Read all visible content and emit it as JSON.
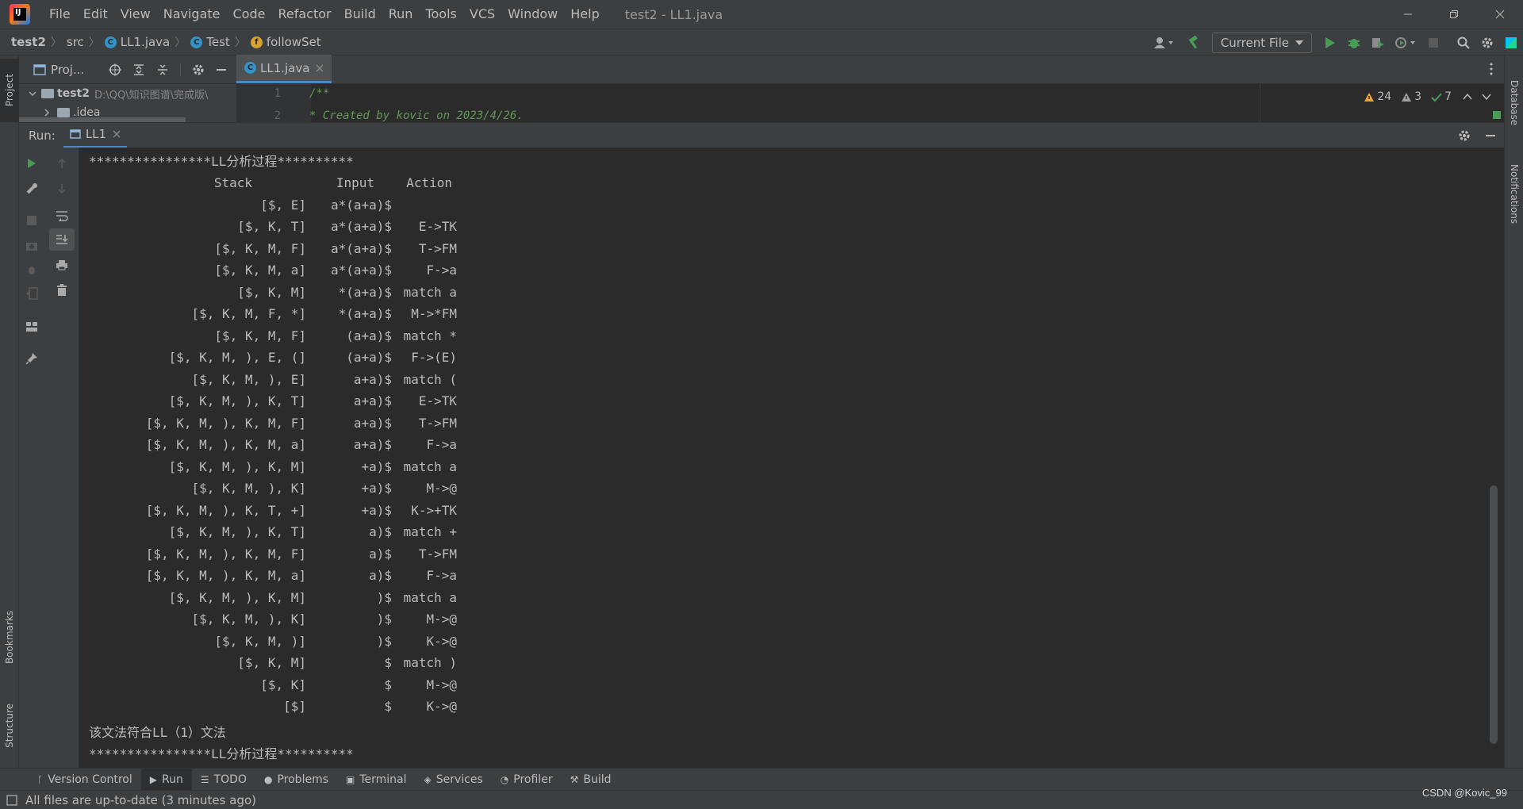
{
  "menubar": {
    "items": [
      "File",
      "Edit",
      "View",
      "Navigate",
      "Code",
      "Refactor",
      "Build",
      "Run",
      "Tools",
      "VCS",
      "Window",
      "Help"
    ],
    "window_title": "test2 - LL1.java"
  },
  "breadcrumbs": {
    "project": "test2",
    "src": "src",
    "file": "LL1.java",
    "class": "Test",
    "method": "followSet"
  },
  "toolbar": {
    "run_config": "Current File"
  },
  "left_strip": {
    "project": "Project",
    "bookmarks": "Bookmarks",
    "structure": "Structure"
  },
  "right_strip": {
    "database": "Database",
    "notifications": "Notifications"
  },
  "project_panel": {
    "title": "Proj...",
    "root_name": "test2",
    "root_path": "D:\\QQ\\知识图谱\\完成版\\",
    "child": ".idea"
  },
  "editor": {
    "tab_label": "LL1.java",
    "lines": [
      {
        "num": "1",
        "text": "/**"
      },
      {
        "num": "2",
        "text": " *  Created by kovic on 2023/4/26."
      }
    ],
    "inspections": {
      "warnings": "24",
      "weak_warnings": "3",
      "typos": "7"
    }
  },
  "run_panel": {
    "label": "Run:",
    "tab": "LL1",
    "console_header": "****************LL分析过程**********",
    "column_headers": {
      "stack": "Stack",
      "input": "Input",
      "action": "Action"
    },
    "rows": [
      {
        "stack": "[$, E]",
        "input": "a*(a+a)$",
        "action": ""
      },
      {
        "stack": "[$, K, T]",
        "input": "a*(a+a)$",
        "action": "E->TK"
      },
      {
        "stack": "[$, K, M, F]",
        "input": "a*(a+a)$",
        "action": "T->FM"
      },
      {
        "stack": "[$, K, M, a]",
        "input": "a*(a+a)$",
        "action": "F->a"
      },
      {
        "stack": "[$, K, M]",
        "input": "*(a+a)$",
        "action": "match a"
      },
      {
        "stack": "[$, K, M, F, *]",
        "input": "*(a+a)$",
        "action": "M->*FM"
      },
      {
        "stack": "[$, K, M, F]",
        "input": "(a+a)$",
        "action": "match *"
      },
      {
        "stack": "[$, K, M, ), E, (]",
        "input": "(a+a)$",
        "action": "F->(E)"
      },
      {
        "stack": "[$, K, M, ), E]",
        "input": "a+a)$",
        "action": "match ("
      },
      {
        "stack": "[$, K, M, ), K, T]",
        "input": "a+a)$",
        "action": "E->TK"
      },
      {
        "stack": "[$, K, M, ), K, M, F]",
        "input": "a+a)$",
        "action": "T->FM"
      },
      {
        "stack": "[$, K, M, ), K, M, a]",
        "input": "a+a)$",
        "action": "F->a"
      },
      {
        "stack": "[$, K, M, ), K, M]",
        "input": "+a)$",
        "action": "match a"
      },
      {
        "stack": "[$, K, M, ), K]",
        "input": "+a)$",
        "action": "M->@"
      },
      {
        "stack": "[$, K, M, ), K, T, +]",
        "input": "+a)$",
        "action": "K->+TK"
      },
      {
        "stack": "[$, K, M, ), K, T]",
        "input": "a)$",
        "action": "match +"
      },
      {
        "stack": "[$, K, M, ), K, M, F]",
        "input": "a)$",
        "action": "T->FM"
      },
      {
        "stack": "[$, K, M, ), K, M, a]",
        "input": "a)$",
        "action": "F->a"
      },
      {
        "stack": "[$, K, M, ), K, M]",
        "input": ")$",
        "action": "match a"
      },
      {
        "stack": "[$, K, M, ), K]",
        "input": ")$",
        "action": "M->@"
      },
      {
        "stack": "[$, K, M, )]",
        "input": ")$",
        "action": "K->@"
      },
      {
        "stack": "[$, K, M]",
        "input": "$",
        "action": "match )"
      },
      {
        "stack": "[$, K]",
        "input": "$",
        "action": "M->@"
      },
      {
        "stack": "[$]",
        "input": "$",
        "action": "K->@"
      }
    ],
    "result": "该文法符合LL（1）文法",
    "console_footer": "****************LL分析过程**********"
  },
  "bottom_tabs": [
    "Version Control",
    "Run",
    "TODO",
    "Problems",
    "Terminal",
    "Services",
    "Profiler",
    "Build"
  ],
  "status": {
    "message": "All files are up-to-date (3 minutes ago)",
    "watermark": "CSDN @Kovic_99"
  },
  "colors": {
    "accent": "#4a88c7",
    "background": "#2b2b2b",
    "panel": "#3c3f41",
    "comment": "#629755",
    "run_green": "#499c54"
  }
}
